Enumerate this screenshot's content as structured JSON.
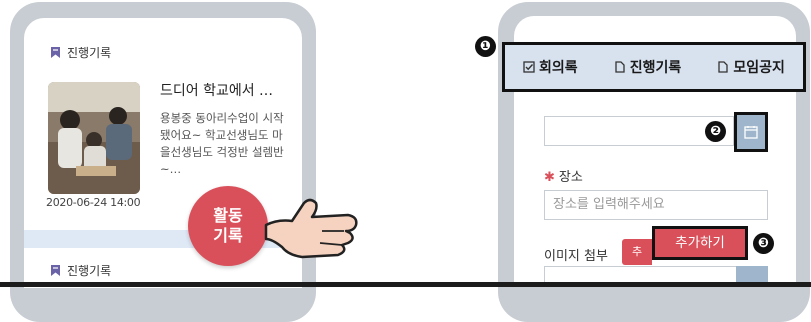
{
  "left_screen": {
    "section_label": "진행기록",
    "card": {
      "title": "드디어 학교에서 …",
      "description": "용봉중 동아리수업이 시작됐어요~ 학교선생님도 마을선생님도 걱정반 설렘반~…",
      "date": "2020-06-24 14:00"
    },
    "fab_line1": "활동",
    "fab_line2": "기록",
    "section_label_2": "진행기록"
  },
  "right_screen": {
    "tabs": [
      {
        "label": "회의록",
        "icon": "checkbox-icon"
      },
      {
        "label": "진행기록",
        "icon": "doc-icon"
      },
      {
        "label": "모임공지",
        "icon": "doc-icon"
      }
    ],
    "markers": [
      "❶",
      "❷",
      "❸"
    ],
    "place_label": "장소",
    "place_placeholder": "장소를 입력해주세요",
    "image_label": "이미지 첨부",
    "small_button_label": "추",
    "add_button_label": "추가하기"
  },
  "colors": {
    "accent_red": "#d9505a",
    "tab_bg": "#d8e2ef",
    "calendar_button": "#9fb5cc",
    "section_icon": "#6b63a8"
  }
}
